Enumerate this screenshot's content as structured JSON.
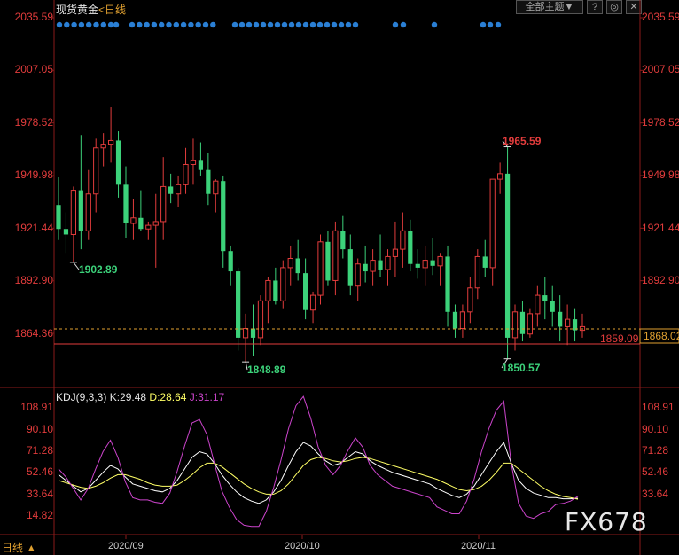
{
  "header": {
    "title": "现货黄金",
    "timeframe": "<日线",
    "theme_button": "全部主题▼",
    "buttons": [
      "?",
      "◎",
      "✕"
    ]
  },
  "price_axis": {
    "labels": [
      "2035.59",
      "2007.05",
      "1978.52",
      "1949.98",
      "1921.44",
      "1892.90",
      "1864.36"
    ],
    "current_price": "1868.02",
    "reference_line_label": "1859.09"
  },
  "annotations": {
    "high_1": "1902.89",
    "low_1": "1848.89",
    "high_2": "1965.59",
    "low_2": "1850.57"
  },
  "kdj": {
    "label": "KDJ(9,3,3)",
    "k": "K:29.48",
    "d": "D:28.64",
    "j": "J:31.17",
    "axis_labels": [
      "108.91",
      "90.10",
      "71.28",
      "52.46",
      "33.64",
      "14.82"
    ]
  },
  "date_labels": [
    "2020/09",
    "2020/10",
    "2020/11"
  ],
  "period_label": "日线",
  "watermark": "FX678",
  "colors": {
    "up": "#e23c3c",
    "down": "#3cd27a",
    "k_line": "#ffffff",
    "d_line": "#ffff66",
    "j_line": "#cc44cc",
    "signal_dot": "#2a7fd4"
  },
  "chart_data": [
    {
      "type": "candlestick",
      "title": "现货黄金 日线",
      "ylim": [
        1840,
        2040
      ],
      "candles": [
        {
          "o": 1934,
          "h": 1949,
          "l": 1915,
          "c": 1921
        },
        {
          "o": 1921,
          "h": 1930,
          "l": 1908,
          "c": 1918
        },
        {
          "o": 1918,
          "h": 1944,
          "l": 1902.89,
          "c": 1942
        },
        {
          "o": 1942,
          "h": 1972,
          "l": 1910,
          "c": 1920
        },
        {
          "o": 1920,
          "h": 1953,
          "l": 1915,
          "c": 1940
        },
        {
          "o": 1940,
          "h": 1970,
          "l": 1930,
          "c": 1965
        },
        {
          "o": 1965,
          "h": 1973,
          "l": 1955,
          "c": 1967
        },
        {
          "o": 1967,
          "h": 1987,
          "l": 1957,
          "c": 1969
        },
        {
          "o": 1969,
          "h": 1974,
          "l": 1938,
          "c": 1945
        },
        {
          "o": 1945,
          "h": 1955,
          "l": 1916,
          "c": 1924
        },
        {
          "o": 1924,
          "h": 1937,
          "l": 1915,
          "c": 1927
        },
        {
          "o": 1927,
          "h": 1942,
          "l": 1920,
          "c": 1921
        },
        {
          "o": 1921,
          "h": 1925,
          "l": 1915,
          "c": 1923
        },
        {
          "o": 1923,
          "h": 1940,
          "l": 1900,
          "c": 1925
        },
        {
          "o": 1925,
          "h": 1960,
          "l": 1915,
          "c": 1944
        },
        {
          "o": 1944,
          "h": 1951,
          "l": 1935,
          "c": 1940
        },
        {
          "o": 1940,
          "h": 1950,
          "l": 1933,
          "c": 1945
        },
        {
          "o": 1945,
          "h": 1965,
          "l": 1940,
          "c": 1956
        },
        {
          "o": 1956,
          "h": 1970,
          "l": 1945,
          "c": 1958
        },
        {
          "o": 1958,
          "h": 1968,
          "l": 1950,
          "c": 1953
        },
        {
          "o": 1953,
          "h": 1962,
          "l": 1934,
          "c": 1940
        },
        {
          "o": 1940,
          "h": 1948,
          "l": 1930,
          "c": 1947
        },
        {
          "o": 1947,
          "h": 1950,
          "l": 1900,
          "c": 1909
        },
        {
          "o": 1909,
          "h": 1912,
          "l": 1890,
          "c": 1898
        },
        {
          "o": 1898,
          "h": 1900,
          "l": 1855,
          "c": 1862
        },
        {
          "o": 1862,
          "h": 1875,
          "l": 1848.89,
          "c": 1867
        },
        {
          "o": 1867,
          "h": 1880,
          "l": 1852,
          "c": 1862
        },
        {
          "o": 1862,
          "h": 1885,
          "l": 1858,
          "c": 1882
        },
        {
          "o": 1882,
          "h": 1895,
          "l": 1870,
          "c": 1893
        },
        {
          "o": 1893,
          "h": 1900,
          "l": 1880,
          "c": 1882
        },
        {
          "o": 1882,
          "h": 1904,
          "l": 1878,
          "c": 1900
        },
        {
          "o": 1900,
          "h": 1912,
          "l": 1890,
          "c": 1905
        },
        {
          "o": 1905,
          "h": 1915,
          "l": 1893,
          "c": 1897
        },
        {
          "o": 1897,
          "h": 1905,
          "l": 1872,
          "c": 1877
        },
        {
          "o": 1877,
          "h": 1887,
          "l": 1870,
          "c": 1885
        },
        {
          "o": 1885,
          "h": 1918,
          "l": 1880,
          "c": 1914
        },
        {
          "o": 1914,
          "h": 1920,
          "l": 1890,
          "c": 1893
        },
        {
          "o": 1893,
          "h": 1925,
          "l": 1885,
          "c": 1920
        },
        {
          "o": 1920,
          "h": 1928,
          "l": 1905,
          "c": 1910
        },
        {
          "o": 1910,
          "h": 1918,
          "l": 1885,
          "c": 1890
        },
        {
          "o": 1890,
          "h": 1905,
          "l": 1882,
          "c": 1902
        },
        {
          "o": 1902,
          "h": 1912,
          "l": 1892,
          "c": 1898
        },
        {
          "o": 1898,
          "h": 1910,
          "l": 1890,
          "c": 1904
        },
        {
          "o": 1904,
          "h": 1918,
          "l": 1895,
          "c": 1899
        },
        {
          "o": 1899,
          "h": 1910,
          "l": 1890,
          "c": 1906
        },
        {
          "o": 1906,
          "h": 1925,
          "l": 1895,
          "c": 1910
        },
        {
          "o": 1910,
          "h": 1930,
          "l": 1900,
          "c": 1920
        },
        {
          "o": 1920,
          "h": 1926,
          "l": 1898,
          "c": 1902
        },
        {
          "o": 1902,
          "h": 1910,
          "l": 1894,
          "c": 1900
        },
        {
          "o": 1900,
          "h": 1912,
          "l": 1890,
          "c": 1904
        },
        {
          "o": 1904,
          "h": 1916,
          "l": 1896,
          "c": 1901
        },
        {
          "o": 1901,
          "h": 1908,
          "l": 1890,
          "c": 1906
        },
        {
          "o": 1906,
          "h": 1912,
          "l": 1868,
          "c": 1876
        },
        {
          "o": 1876,
          "h": 1880,
          "l": 1862,
          "c": 1867
        },
        {
          "o": 1867,
          "h": 1880,
          "l": 1862,
          "c": 1876
        },
        {
          "o": 1876,
          "h": 1895,
          "l": 1870,
          "c": 1889
        },
        {
          "o": 1889,
          "h": 1910,
          "l": 1883,
          "c": 1906
        },
        {
          "o": 1906,
          "h": 1915,
          "l": 1895,
          "c": 1900
        },
        {
          "o": 1900,
          "h": 1935,
          "l": 1890,
          "c": 1948
        },
        {
          "o": 1948,
          "h": 1957,
          "l": 1940,
          "c": 1951
        },
        {
          "o": 1951,
          "h": 1965.59,
          "l": 1850.57,
          "c": 1862
        },
        {
          "o": 1862,
          "h": 1880,
          "l": 1855,
          "c": 1876
        },
        {
          "o": 1876,
          "h": 1882,
          "l": 1860,
          "c": 1864
        },
        {
          "o": 1864,
          "h": 1878,
          "l": 1862,
          "c": 1875
        },
        {
          "o": 1875,
          "h": 1890,
          "l": 1868,
          "c": 1885
        },
        {
          "o": 1885,
          "h": 1895,
          "l": 1872,
          "c": 1882
        },
        {
          "o": 1882,
          "h": 1890,
          "l": 1868,
          "c": 1876
        },
        {
          "o": 1876,
          "h": 1885,
          "l": 1860,
          "c": 1868
        },
        {
          "o": 1868,
          "h": 1880,
          "l": 1858,
          "c": 1872
        },
        {
          "o": 1872,
          "h": 1878,
          "l": 1860,
          "c": 1866
        },
        {
          "o": 1866,
          "h": 1875,
          "l": 1862,
          "c": 1868
        }
      ]
    },
    {
      "type": "line",
      "title": "KDJ(9,3,3)",
      "ylim": [
        0,
        115
      ],
      "series": [
        {
          "name": "K",
          "values": [
            50,
            45,
            40,
            35,
            38,
            45,
            52,
            58,
            55,
            48,
            42,
            40,
            38,
            36,
            35,
            38,
            45,
            55,
            65,
            70,
            68,
            60,
            50,
            42,
            35,
            30,
            27,
            25,
            28,
            35,
            45,
            58,
            70,
            78,
            75,
            68,
            62,
            58,
            60,
            65,
            70,
            68,
            62,
            58,
            55,
            52,
            50,
            48,
            46,
            44,
            42,
            38,
            35,
            32,
            30,
            33,
            40,
            50,
            60,
            70,
            78,
            60,
            45,
            38,
            34,
            32,
            30,
            30,
            29,
            29,
            29.48
          ]
        },
        {
          "name": "D",
          "values": [
            45,
            43,
            41,
            39,
            38,
            40,
            43,
            47,
            50,
            50,
            48,
            46,
            43,
            41,
            40,
            40,
            41,
            45,
            50,
            56,
            60,
            60,
            57,
            52,
            47,
            42,
            38,
            35,
            33,
            33,
            36,
            42,
            50,
            58,
            63,
            65,
            64,
            62,
            61,
            62,
            64,
            65,
            64,
            62,
            60,
            58,
            56,
            54,
            52,
            50,
            48,
            46,
            43,
            40,
            37,
            36,
            37,
            40,
            45,
            52,
            60,
            60,
            55,
            50,
            45,
            40,
            36,
            33,
            31,
            30,
            28.64
          ]
        },
        {
          "name": "J",
          "values": [
            55,
            48,
            38,
            28,
            38,
            55,
            70,
            80,
            65,
            44,
            30,
            28,
            28,
            26,
            25,
            34,
            53,
            75,
            95,
            98,
            85,
            60,
            36,
            22,
            11,
            6,
            5,
            5,
            18,
            39,
            63,
            90,
            110,
            118,
            99,
            74,
            58,
            50,
            58,
            71,
            82,
            74,
            58,
            50,
            45,
            40,
            38,
            36,
            34,
            32,
            30,
            22,
            19,
            16,
            16,
            27,
            46,
            70,
            90,
            106,
            114,
            60,
            25,
            14,
            12,
            16,
            18,
            24,
            25,
            27,
            31.17
          ]
        }
      ]
    }
  ]
}
